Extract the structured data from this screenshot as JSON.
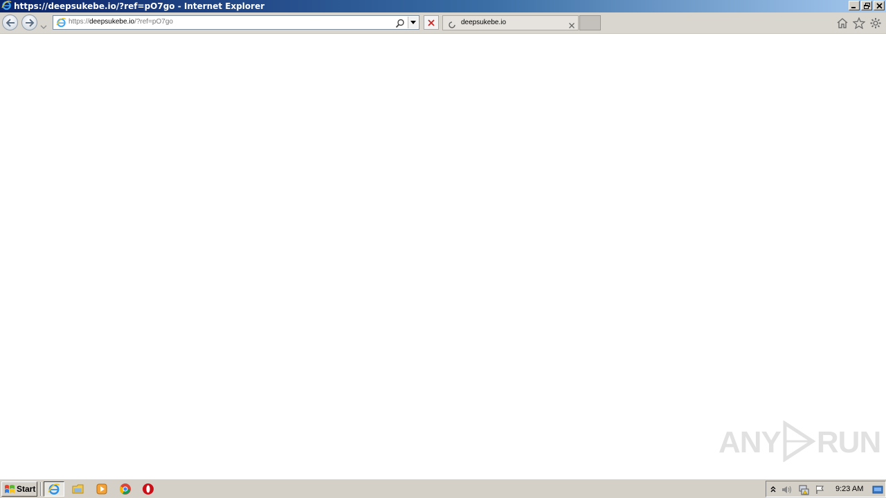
{
  "window": {
    "title": "https://deepsukebe.io/?ref=pO7go - Internet Explorer"
  },
  "address_bar": {
    "url_prefix": "https://",
    "url_domain": "deepsukebe.io",
    "url_path": "/?ref=pO7go"
  },
  "tabs": [
    {
      "title": "deepsukebe.io",
      "loading": true
    }
  ],
  "watermark": {
    "text_left": "ANY",
    "text_right": "RUN"
  },
  "taskbar": {
    "start_label": "Start",
    "quick_launch": [
      "internet-explorer-icon",
      "folder-icon",
      "media-player-icon",
      "chrome-icon",
      "opera-icon"
    ],
    "clock": "9:23 AM"
  },
  "colors": {
    "titlebar_start": "#0a246a",
    "titlebar_end": "#a6caf0",
    "chrome_bg": "#d4d0c8",
    "stop_red": "#cc2222"
  }
}
